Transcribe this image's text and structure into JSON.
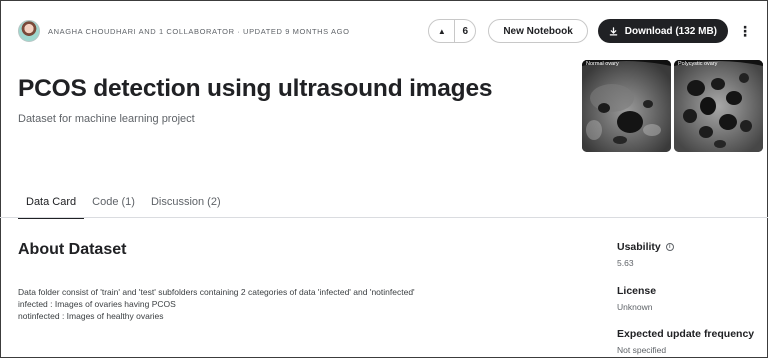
{
  "header": {
    "byline": "ANAGHA CHOUDHARI AND 1 COLLABORATOR · UPDATED 9 MONTHS AGO",
    "vote_count": "6",
    "new_notebook_label": "New Notebook",
    "download_label": "Download (132 MB)",
    "more_glyph": "⋮"
  },
  "dataset": {
    "title": "PCOS detection using ultrasound images",
    "subtitle": "Dataset for machine learning project"
  },
  "cover_images": [
    {
      "label": "Normal ovary"
    },
    {
      "label": "Polycystic ovary"
    }
  ],
  "tabs": [
    {
      "label": "Data Card"
    },
    {
      "label": "Code (1)"
    },
    {
      "label": "Discussion (2)"
    }
  ],
  "about": {
    "heading": "About Dataset",
    "lines": [
      "Data folder consist of 'train' and 'test' subfolders containing 2 categories of data 'infected' and 'notinfected'",
      "infected : Images of ovaries having PCOS",
      "notinfected : Images of healthy ovaries"
    ]
  },
  "metadata": {
    "usability_label": "Usability",
    "usability_value": "5.63",
    "license_label": "License",
    "license_value": "Unknown",
    "update_label": "Expected update frequency",
    "update_value": "Not specified"
  },
  "colors": {
    "primary_text": "#202124",
    "secondary_text": "#5f6368",
    "download_bg": "#202124",
    "border": "#c8c8c8"
  },
  "icons": {
    "upvote": "upvote-arrow-icon",
    "download": "download-icon",
    "more": "more-vertical-icon",
    "info": "info-icon"
  }
}
